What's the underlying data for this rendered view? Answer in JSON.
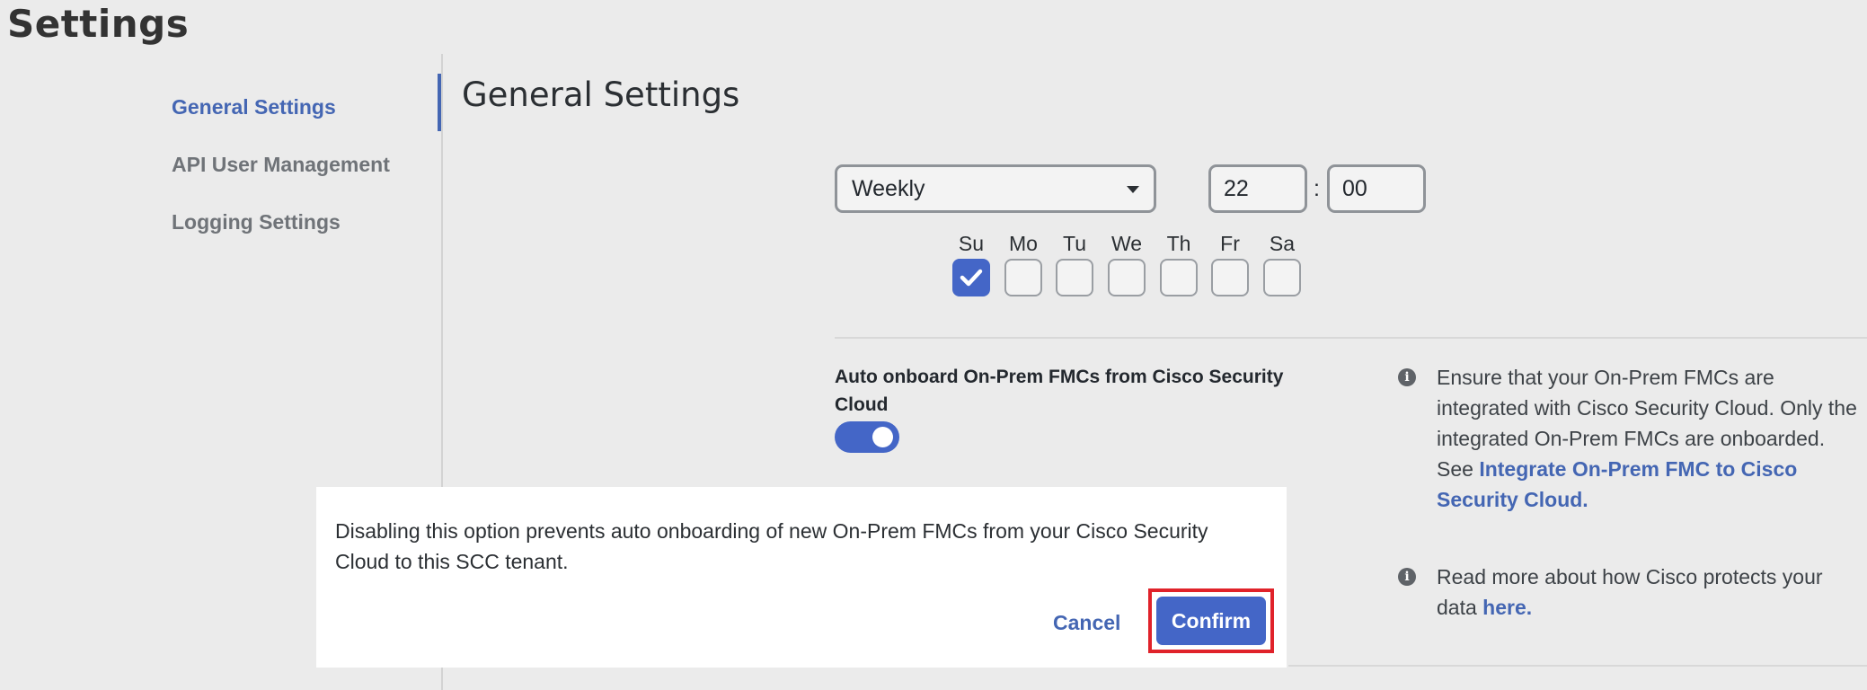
{
  "page": {
    "title": "Settings"
  },
  "sidebar": {
    "items": [
      {
        "label": "General Settings",
        "active": true
      },
      {
        "label": "API User Management",
        "active": false
      },
      {
        "label": "Logging Settings",
        "active": false
      }
    ]
  },
  "main": {
    "section_title": "General Settings",
    "schedule": {
      "frequency": "Weekly",
      "hour": "22",
      "separator": ":",
      "minute": "00",
      "days": [
        {
          "label": "Su",
          "checked": true
        },
        {
          "label": "Mo",
          "checked": false
        },
        {
          "label": "Tu",
          "checked": false
        },
        {
          "label": "We",
          "checked": false
        },
        {
          "label": "Th",
          "checked": false
        },
        {
          "label": "Fr",
          "checked": false
        },
        {
          "label": "Sa",
          "checked": false
        }
      ]
    },
    "auto_onboard": {
      "label": "Auto onboard On-Prem FMCs from Cisco Security Cloud",
      "enabled": true,
      "info_text": "Ensure that your On-Prem FMCs are integrated with Cisco Security Cloud. Only the integrated On-Prem FMCs are onboarded. See",
      "info_link": "Integrate On-Prem FMC to Cisco Security Cloud."
    },
    "data_info": {
      "text": "Read more about how Cisco protects your data",
      "link": "here."
    }
  },
  "dialog": {
    "message": "Disabling this option prevents auto onboarding of new On-Prem FMCs from your Cisco Security Cloud to this SCC tenant.",
    "cancel_label": "Cancel",
    "confirm_label": "Confirm"
  },
  "colors": {
    "accent": "#4466c7",
    "highlight": "#e0222a"
  }
}
